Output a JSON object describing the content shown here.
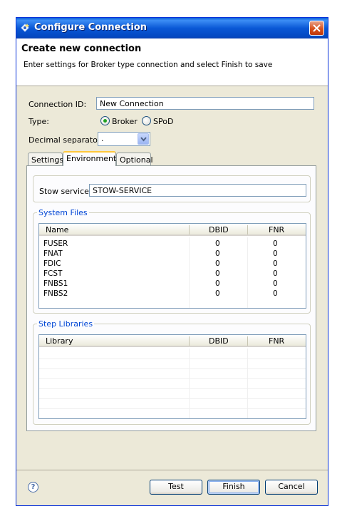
{
  "window": {
    "title": "Configure Connection"
  },
  "header": {
    "title": "Create new connection",
    "message": "Enter settings for Broker type connection and select Finish to save"
  },
  "form": {
    "connection_id_label": "Connection ID:",
    "connection_id_value": "New Connection",
    "type_label": "Type:",
    "type_options": [
      "Broker",
      "SPoD"
    ],
    "type_selected": "Broker",
    "decimal_label": "Decimal separator:",
    "decimal_value": "."
  },
  "tabs": [
    "Settings",
    "Environment",
    "Optional"
  ],
  "active_tab": "Environment",
  "environment": {
    "stow_label": "Stow service:",
    "stow_value": "STOW-SERVICE",
    "system_files": {
      "legend": "System Files",
      "columns": [
        "Name",
        "DBID",
        "FNR"
      ],
      "rows": [
        [
          "FUSER",
          "0",
          "0"
        ],
        [
          "FNAT",
          "0",
          "0"
        ],
        [
          "FDIC",
          "0",
          "0"
        ],
        [
          "FCST",
          "0",
          "0"
        ],
        [
          "FNBS1",
          "0",
          "0"
        ],
        [
          "FNBS2",
          "0",
          "0"
        ]
      ]
    },
    "step_libraries": {
      "legend": "Step Libraries",
      "columns": [
        "Library",
        "DBID",
        "FNR"
      ],
      "rows": []
    }
  },
  "buttons": {
    "help": "?",
    "test": "Test",
    "finish": "Finish",
    "cancel": "Cancel"
  }
}
